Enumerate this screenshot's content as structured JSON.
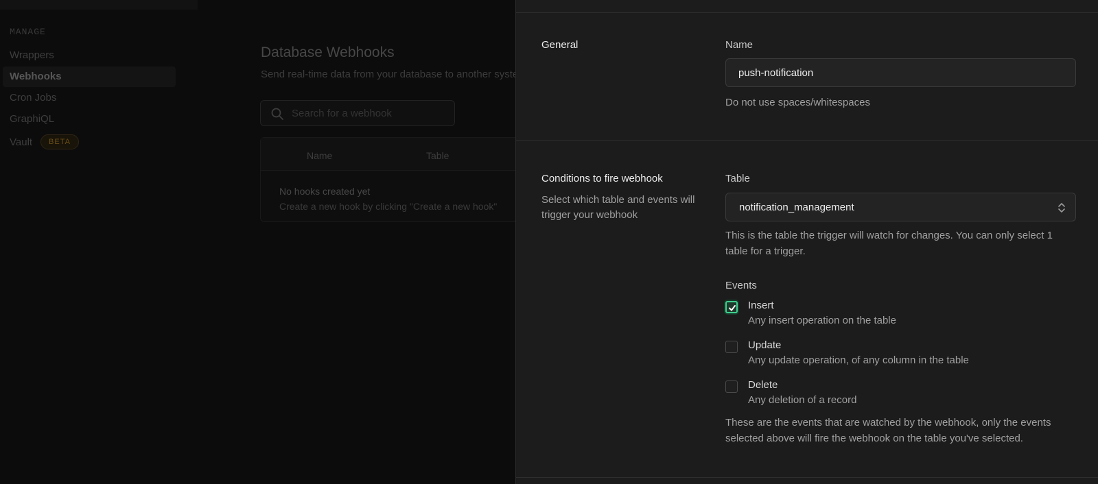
{
  "sidebar": {
    "section_label": "MANAGE",
    "items": [
      {
        "label": "Wrappers"
      },
      {
        "label": "Webhooks"
      },
      {
        "label": "Cron Jobs"
      },
      {
        "label": "GraphiQL"
      },
      {
        "label": "Vault"
      }
    ],
    "beta_badge": "BETA"
  },
  "main": {
    "title": "Database Webhooks",
    "subtitle": "Send real-time data from your database to another system when a table event occurs",
    "search_placeholder": "Search for a webhook",
    "table": {
      "columns": [
        "Name",
        "Table"
      ],
      "empty_title": "No hooks created yet",
      "empty_subtitle": "Create a new hook by clicking \"Create a new hook\""
    }
  },
  "panel": {
    "general": {
      "section_title": "General",
      "name_label": "Name",
      "name_value": "push-notification",
      "name_hint": "Do not use spaces/whitespaces"
    },
    "conditions": {
      "section_title": "Conditions to fire webhook",
      "section_desc": "Select which table and events will trigger your webhook",
      "table_label": "Table",
      "table_value": "notification_management",
      "table_hint": "This is the table the trigger will watch for changes. You can only select 1 table for a trigger.",
      "events_label": "Events",
      "events": [
        {
          "name": "Insert",
          "desc": "Any insert operation on the table",
          "checked": true
        },
        {
          "name": "Update",
          "desc": "Any update operation, of any column in the table",
          "checked": false
        },
        {
          "name": "Delete",
          "desc": "Any deletion of a record",
          "checked": false
        }
      ],
      "events_hint": "These are the events that are watched by the webhook, only the events selected above will fire the webhook on the table you've selected."
    }
  },
  "colors": {
    "accent": "#3ecf8e",
    "panel_bg": "#1c1c1c",
    "backdrop_bg": "#0c0c0c"
  },
  "icons": {
    "search": "search-icon",
    "select_arrows": "chevron-up-down-icon",
    "check": "check-icon"
  }
}
